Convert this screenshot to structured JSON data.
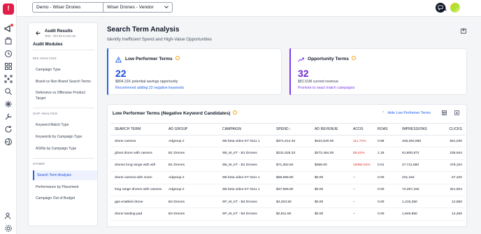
{
  "topbar": {
    "account_select": "Demo - Wiser Drones",
    "profile_select": "Wiser Drones - Vendor"
  },
  "logo_text": "!",
  "nav_expand": "›",
  "sidebar": {
    "title": "Audit Results",
    "subtitle": "Test - Oct 01 to Oct 15",
    "modules_heading": "Audit Modules",
    "sections": [
      {
        "heading": "MIX ANALYSIS",
        "items": [
          "Campaign Type",
          "Brand vs Non-Brand Search Terms",
          "Defensive vs Offensive Product",
          "Target"
        ]
      },
      {
        "heading": "GAP ANALYSIS",
        "items": [
          "Keyword Match Type",
          "Keywords by Campaign Type",
          "ASINs by Campaign Type"
        ]
      },
      {
        "heading": "OTHER",
        "items": [
          "Search Term Analysis",
          "Performance by Placement",
          "Campaign Out of Budget"
        ]
      }
    ]
  },
  "page": {
    "title": "Search Term Analysis",
    "subtitle": "Identify Inefficient Spend and High-Value Opportunities"
  },
  "cards": [
    {
      "title": "Low Performer Terms",
      "value": "22",
      "desc": "$804.31K potential savings opportunity",
      "link": "Recommend adding 22 negative keywords",
      "accent": "#2563eb",
      "value_color": "#1d4ed8",
      "link_color": "#2563eb"
    },
    {
      "title": "Opportunity Terms",
      "value": "32",
      "desc": "$81.51M current revenue",
      "link": "Promote to exact match campaigns",
      "accent": "#7c3aed",
      "value_color": "#6d28d9",
      "link_color": "#7c3aed"
    }
  ],
  "table": {
    "title": "Low Performer Terms (Negative Keyword Candidates)",
    "hide_label": "Hide Low Performer Terms",
    "columns": [
      "SEARCH TERM",
      "AD GROUP",
      "CAMPAIGN",
      "SPEND",
      "AD REVENUE",
      "ACOS",
      "ROAS",
      "IMPRESSIONS",
      "CLICKS"
    ],
    "sort_indicator": "↓",
    "rows": [
      [
        "drone camera",
        "Adgroup 2",
        "SB beta video KT 0111 1",
        "$371,614.40",
        "$424,520.00",
        "111.71%",
        "0.86",
        "346,282,680",
        "561,040"
      ],
      [
        "ghost drone with camera",
        "B1 Drones",
        "SB_M_KT - B1 Drones",
        "$231,625.33",
        "$272,484.00",
        "85.01%",
        "1.18",
        "61,800,972",
        "235,944"
      ],
      [
        "drones long range with wifi",
        "B1 Drones",
        "SB_M_KT - B1 Drones",
        "$71,362.60",
        "$368.00",
        "19392.01%",
        "0.01",
        "47,711,560",
        "478,104"
      ],
      [
        "drone camera with zoom",
        "Adgroup 2",
        "SB beta video KT 0111 1",
        "$68,686.80",
        "$0.00",
        "--",
        "0.00",
        "231,164",
        "67,220"
      ],
      [
        "long range drones with camera",
        "Adgroup 2",
        "SB beta video KT 0111 1",
        "$37,596.80",
        "$0.00",
        "--",
        "0.00",
        "72,487,192",
        "321,924"
      ],
      [
        "gps enabled drone",
        "B4 Drones",
        "SP_M_KT - B4 Drones",
        "$4,203.50",
        "$0.00",
        "--",
        "0.00",
        "1,215,250",
        "12,850"
      ],
      [
        "drone landing pad",
        "B4 Drones",
        "SP_M_KT - B4 Drones",
        "$2,911.50",
        "$0.00",
        "--",
        "0.00",
        "1,849,950",
        "12,450"
      ]
    ],
    "red_cells": [
      [
        0,
        5
      ],
      [
        1,
        5
      ],
      [
        2,
        5
      ]
    ]
  },
  "colors": {
    "accent": "#2563eb",
    "brand": "#e11d48",
    "danger": "#dc2626"
  }
}
